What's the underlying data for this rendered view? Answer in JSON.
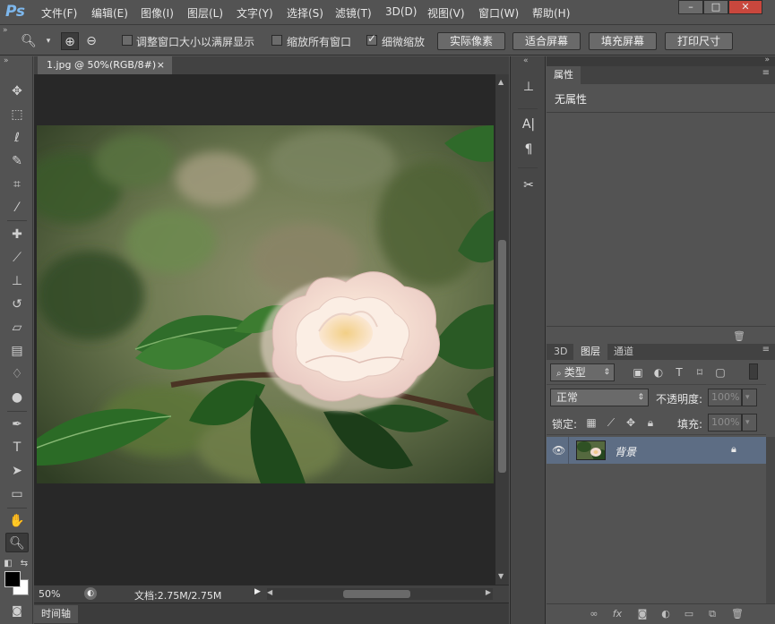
{
  "app": {
    "logo": "Ps",
    "menu": [
      "文件(F)",
      "编辑(E)",
      "图像(I)",
      "图层(L)",
      "文字(Y)",
      "选择(S)",
      "滤镜(T)",
      "3D(D)",
      "视图(V)",
      "窗口(W)",
      "帮助(H)"
    ],
    "window_buttons": {
      "minimize": "–",
      "maximize": "□",
      "close": "✕"
    }
  },
  "options_bar": {
    "checkbox_resize_window": {
      "label": "调整窗口大小以满屏显示",
      "checked": false
    },
    "checkbox_zoom_all": {
      "label": "缩放所有窗口",
      "checked": false
    },
    "checkbox_scrubby": {
      "label": "细微缩放",
      "checked": true
    },
    "buttons": [
      "实际像素",
      "适合屏幕",
      "填充屏幕",
      "打印尺寸"
    ]
  },
  "document": {
    "tab_title": "1.jpg @ 50%(RGB/8#)",
    "tab_close": "×",
    "zoom": "50%",
    "doc_info": "文档:2.75M/2.75M"
  },
  "timeline": {
    "label": "时间轴"
  },
  "properties_panel": {
    "tab": "属性",
    "content": "无属性"
  },
  "layers_panel": {
    "tabs": [
      "3D",
      "图层",
      "通道"
    ],
    "active_tab": "图层",
    "filter_kind": "类型",
    "blend_mode": "正常",
    "opacity_label": "不透明度:",
    "opacity_value": "100%",
    "lock_label": "锁定:",
    "fill_label": "填充:",
    "fill_value": "100%",
    "layer": {
      "name": "背景",
      "visible": true,
      "locked": true
    }
  },
  "colors": {
    "accent_logo": "#7db7ec",
    "selected_layer": "#5d6d84",
    "panel_bg": "#535353",
    "canvas_bg": "#282828"
  }
}
